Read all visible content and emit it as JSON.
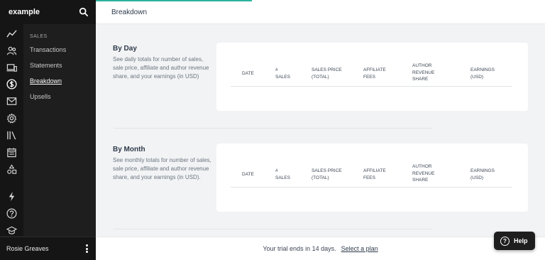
{
  "brand": "example",
  "user": {
    "name": "Rosie Greaves"
  },
  "sidebar": {
    "section_heading": "SALES",
    "items": [
      {
        "label": "Transactions"
      },
      {
        "label": "Statements"
      },
      {
        "label": "Breakdown"
      },
      {
        "label": "Upsells"
      }
    ],
    "rail_icons": [
      "trend-icon",
      "users-icon",
      "devices-icon",
      "dollar-icon",
      "mail-icon",
      "gear-icon",
      "library-icon",
      "calendar-icon",
      "shapes-icon",
      "bolt-icon",
      "question-icon",
      "graduation-cap-icon"
    ]
  },
  "header": {
    "title": "Breakdown"
  },
  "table_columns": [
    {
      "label": "DATE"
    },
    {
      "label": "# SALES"
    },
    {
      "label": "SALES PRICE (TOTAL)"
    },
    {
      "label": "AFFILIATE FEES"
    },
    {
      "label": "AUTHOR REVENUE SHARE"
    },
    {
      "label": "EARNINGS (USD)"
    }
  ],
  "sections": [
    {
      "title": "By Day",
      "description": "See daily totals for number of sales, sale price, affiliate and author revenue share, and your earnings (in USD)"
    },
    {
      "title": "By Month",
      "description": "See monthly totals for number of sales, sale price, affiliate and author revenue share, and your earnings (in USD)."
    }
  ],
  "trial": {
    "message": "Your trial ends in 14 days.",
    "link": "Select a plan"
  },
  "help": {
    "label": "Help"
  },
  "colors": {
    "accent": "#2bb39b",
    "sidebar": "#1e1e1e"
  }
}
